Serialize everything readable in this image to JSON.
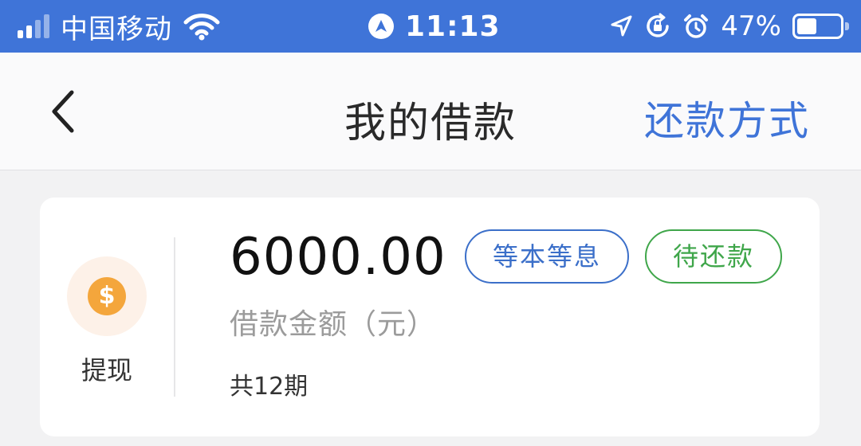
{
  "status_bar": {
    "carrier": "中国移动",
    "time": "11:13",
    "battery_percent": "47%",
    "battery_level": 0.47,
    "icons": [
      "signal-icon",
      "wifi-icon",
      "navigation-icon",
      "location-arrow-icon",
      "rotation-lock-icon",
      "alarm-icon",
      "battery-icon"
    ]
  },
  "nav": {
    "title": "我的借款",
    "action": "还款方式",
    "back_icon": "chevron-left-icon"
  },
  "loan_card": {
    "icon": "dollar-coin-icon",
    "type_label": "提现",
    "amount": "6000.00",
    "amount_label": "借款金额（元）",
    "periods": "共12期",
    "tags": {
      "repayment_type": "等本等息",
      "status": "待还款"
    }
  },
  "colors": {
    "status_bar_bg": "#3f74d8",
    "accent_blue": "#3f74d8",
    "status_green": "#3fa64a",
    "coin_orange": "#f4a63c"
  }
}
